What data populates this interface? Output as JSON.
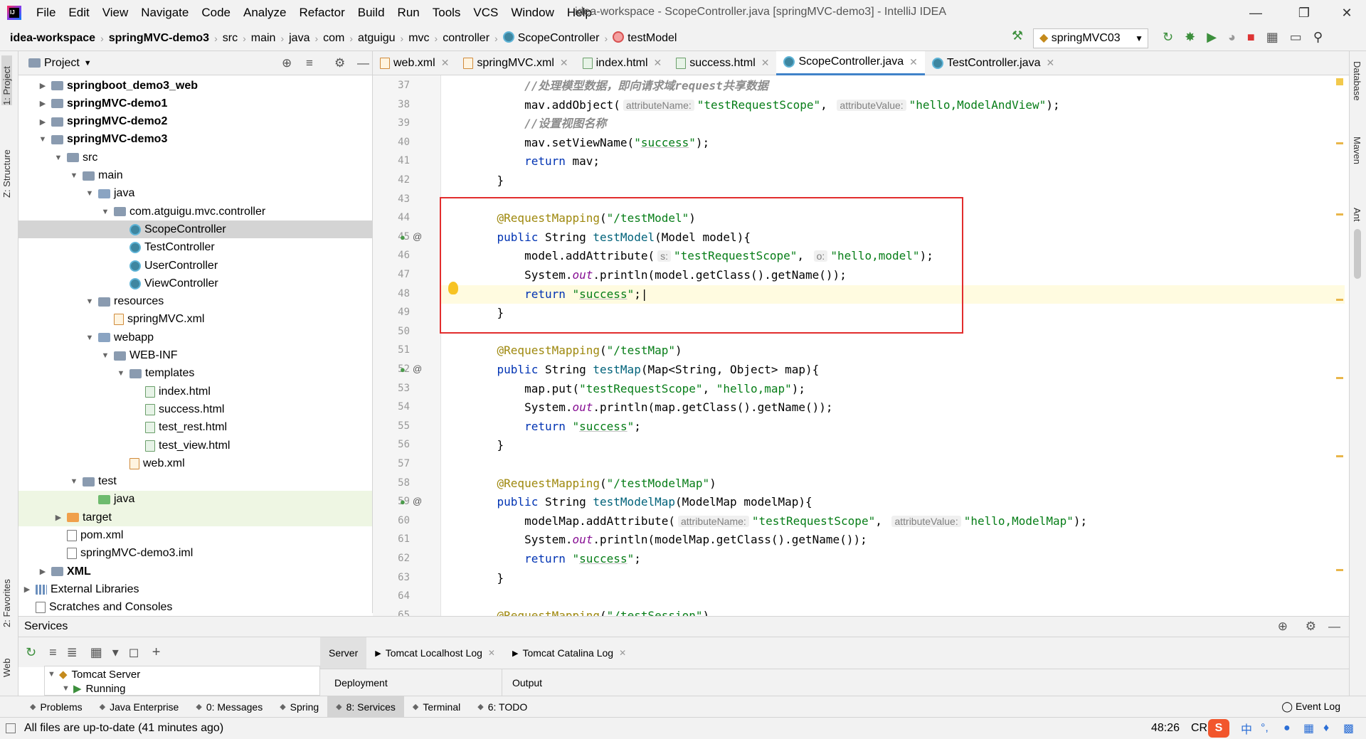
{
  "menu": {
    "items": [
      "File",
      "Edit",
      "View",
      "Navigate",
      "Code",
      "Analyze",
      "Refactor",
      "Build",
      "Run",
      "Tools",
      "VCS",
      "Window",
      "Help"
    ],
    "window_title": "idea-workspace - ScopeController.java [springMVC-demo3] - IntelliJ IDEA"
  },
  "breadcrumb": {
    "items": [
      {
        "label": "idea-workspace",
        "bold": true
      },
      {
        "label": "springMVC-demo3",
        "bold": true
      },
      {
        "label": "src"
      },
      {
        "label": "main"
      },
      {
        "label": "java"
      },
      {
        "label": "com"
      },
      {
        "label": "atguigu"
      },
      {
        "label": "mvc"
      },
      {
        "label": "controller"
      },
      {
        "label": "ScopeController",
        "icon": "class-icon"
      },
      {
        "label": "testModel",
        "icon": "method-icon"
      }
    ]
  },
  "run_config": {
    "label": "springMVC03"
  },
  "project_panel": {
    "title": "Project",
    "tree": [
      {
        "label": "springboot_demo3_web",
        "depth": 1,
        "arrow": "▶",
        "icon": "module",
        "bold": true
      },
      {
        "label": "springMVC-demo1",
        "depth": 1,
        "arrow": "▶",
        "icon": "module",
        "bold": true
      },
      {
        "label": "springMVC-demo2",
        "depth": 1,
        "arrow": "▶",
        "icon": "module",
        "bold": true
      },
      {
        "label": "springMVC-demo3",
        "depth": 1,
        "arrow": "▼",
        "icon": "module",
        "bold": true
      },
      {
        "label": "src",
        "depth": 2,
        "arrow": "▼",
        "icon": "folder"
      },
      {
        "label": "main",
        "depth": 3,
        "arrow": "▼",
        "icon": "folder"
      },
      {
        "label": "java",
        "depth": 4,
        "arrow": "▼",
        "icon": "folder-src"
      },
      {
        "label": "com.atguigu.mvc.controller",
        "depth": 5,
        "arrow": "▼",
        "icon": "package"
      },
      {
        "label": "ScopeController",
        "depth": 6,
        "arrow": "",
        "icon": "class",
        "selected": true
      },
      {
        "label": "TestController",
        "depth": 6,
        "arrow": "",
        "icon": "class"
      },
      {
        "label": "UserController",
        "depth": 6,
        "arrow": "",
        "icon": "class"
      },
      {
        "label": "ViewController",
        "depth": 6,
        "arrow": "",
        "icon": "class"
      },
      {
        "label": "resources",
        "depth": 4,
        "arrow": "▼",
        "icon": "folder-res"
      },
      {
        "label": "springMVC.xml",
        "depth": 5,
        "arrow": "",
        "icon": "xml"
      },
      {
        "label": "webapp",
        "depth": 4,
        "arrow": "▼",
        "icon": "folder-web"
      },
      {
        "label": "WEB-INF",
        "depth": 5,
        "arrow": "▼",
        "icon": "folder"
      },
      {
        "label": "templates",
        "depth": 6,
        "arrow": "▼",
        "icon": "folder"
      },
      {
        "label": "index.html",
        "depth": 7,
        "arrow": "",
        "icon": "html"
      },
      {
        "label": "success.html",
        "depth": 7,
        "arrow": "",
        "icon": "html"
      },
      {
        "label": "test_rest.html",
        "depth": 7,
        "arrow": "",
        "icon": "html"
      },
      {
        "label": "test_view.html",
        "depth": 7,
        "arrow": "",
        "icon": "html"
      },
      {
        "label": "web.xml",
        "depth": 6,
        "arrow": "",
        "icon": "xml"
      },
      {
        "label": "test",
        "depth": 3,
        "arrow": "▼",
        "icon": "folder"
      },
      {
        "label": "java",
        "depth": 4,
        "arrow": "",
        "icon": "folder-test",
        "highlight": true
      },
      {
        "label": "target",
        "depth": 2,
        "arrow": "▶",
        "icon": "folder-target",
        "highlight": true
      },
      {
        "label": "pom.xml",
        "depth": 2,
        "arrow": "",
        "icon": "maven"
      },
      {
        "label": "springMVC-demo3.iml",
        "depth": 2,
        "arrow": "",
        "icon": "file"
      },
      {
        "label": "XML",
        "depth": 1,
        "arrow": "▶",
        "icon": "module",
        "bold": true
      },
      {
        "label": "External Libraries",
        "depth": 0,
        "arrow": "▶",
        "icon": "lib"
      },
      {
        "label": "Scratches and Consoles",
        "depth": 0,
        "arrow": "",
        "icon": "scratch"
      }
    ]
  },
  "editor_tabs": [
    {
      "label": "web.xml",
      "icon": "xml"
    },
    {
      "label": "springMVC.xml",
      "icon": "xml"
    },
    {
      "label": "index.html",
      "icon": "html"
    },
    {
      "label": "success.html",
      "icon": "html"
    },
    {
      "label": "ScopeController.java",
      "icon": "class",
      "active": true
    },
    {
      "label": "TestController.java",
      "icon": "class"
    }
  ],
  "editor": {
    "lines": [
      {
        "n": "37",
        "html": "        <span class=\"cmt-cn\">//处理模型数据，即向请求域request共享数据</span>"
      },
      {
        "n": "38",
        "html": "        mav.addObject(<span class=\"hint\">attributeName:</span><span class=\"str\">\"testRequestScope\"</span>, <span class=\"hint\">attributeValue:</span><span class=\"str\">\"hello,ModelAndView\"</span>);"
      },
      {
        "n": "39",
        "html": "        <span class=\"cmt-cn\">//设置视图名称</span>"
      },
      {
        "n": "40",
        "html": "        mav.setViewName(<span class=\"str\">\"<span class=\"und\">success</span>\"</span>);"
      },
      {
        "n": "41",
        "html": "        <span class=\"kw\">return</span> mav;"
      },
      {
        "n": "42",
        "html": "    }"
      },
      {
        "n": "43",
        "html": ""
      },
      {
        "n": "44",
        "html": "    <span class=\"ann\">@RequestMapping</span>(<span class=\"str\">\"/testModel\"</span>)"
      },
      {
        "n": "45",
        "html": "    <span class=\"kw\">public</span> String <span class=\"mth\">testModel</span>(Model model){",
        "gutter": true
      },
      {
        "n": "46",
        "html": "        model.addAttribute(<span class=\"hint\">s:</span><span class=\"str\">\"testRequestScope\"</span>, <span class=\"hint\">o:</span><span class=\"str\">\"hello,model\"</span>);"
      },
      {
        "n": "47",
        "html": "        System.<span class=\"fld\">out</span>.println(model.getClass().getName());"
      },
      {
        "n": "48",
        "html": "        <span class=\"kw\">return</span> <span class=\"str\">\"<span class=\"und\">success</span>\"</span>;|",
        "caret": true
      },
      {
        "n": "49",
        "html": "    }"
      },
      {
        "n": "50",
        "html": ""
      },
      {
        "n": "51",
        "html": "    <span class=\"ann\">@RequestMapping</span>(<span class=\"str\">\"/testMap\"</span>)"
      },
      {
        "n": "52",
        "html": "    <span class=\"kw\">public</span> String <span class=\"mth\">testMap</span>(Map&lt;String, Object&gt; map){",
        "gutter": true
      },
      {
        "n": "53",
        "html": "        map.put(<span class=\"str\">\"testRequestScope\"</span>, <span class=\"str\">\"hello,map\"</span>);"
      },
      {
        "n": "54",
        "html": "        System.<span class=\"fld\">out</span>.println(map.getClass().getName());"
      },
      {
        "n": "55",
        "html": "        <span class=\"kw\">return</span> <span class=\"str\">\"<span class=\"und\">success</span>\"</span>;"
      },
      {
        "n": "56",
        "html": "    }"
      },
      {
        "n": "57",
        "html": ""
      },
      {
        "n": "58",
        "html": "    <span class=\"ann\">@RequestMapping</span>(<span class=\"str\">\"/testModelMap\"</span>)"
      },
      {
        "n": "59",
        "html": "    <span class=\"kw\">public</span> String <span class=\"mth\">testModelMap</span>(ModelMap modelMap){",
        "gutter": true
      },
      {
        "n": "60",
        "html": "        modelMap.addAttribute(<span class=\"hint\">attributeName:</span><span class=\"str\">\"testRequestScope\"</span>, <span class=\"hint\">attributeValue:</span><span class=\"str\">\"hello,ModelMap\"</span>);"
      },
      {
        "n": "61",
        "html": "        System.<span class=\"fld\">out</span>.println(modelMap.getClass().getName());"
      },
      {
        "n": "62",
        "html": "        <span class=\"kw\">return</span> <span class=\"str\">\"<span class=\"und\">success</span>\"</span>;"
      },
      {
        "n": "63",
        "html": "    }"
      },
      {
        "n": "64",
        "html": ""
      },
      {
        "n": "65",
        "html": "    <span class=\"ann\">@RequestMapping</span>(<span class=\"str\">\"/testSession\"</span>)"
      }
    ]
  },
  "left_stripe": {
    "project_tab": "1: Project",
    "structure_tab": "Z: Structure",
    "favorites_tab": "2: Favorites",
    "web_tab": "Web"
  },
  "right_stripe": {
    "database_tab": "Database",
    "maven_tab": "Maven",
    "ant_tab": "Ant"
  },
  "services": {
    "title": "Services",
    "tree_items": [
      "Tomcat Server",
      "Running"
    ],
    "tabs": [
      {
        "label": "Server",
        "active": true
      },
      {
        "label": "Tomcat Localhost Log"
      },
      {
        "label": "Tomcat Catalina Log"
      }
    ],
    "sub_tabs": [
      "Deployment",
      "Output"
    ]
  },
  "tool_windows": [
    {
      "label": "Problems"
    },
    {
      "label": "Java Enterprise"
    },
    {
      "label": "0: Messages"
    },
    {
      "label": "Spring"
    },
    {
      "label": "8: Services",
      "active": true
    },
    {
      "label": "Terminal"
    },
    {
      "label": "6: TODO"
    }
  ],
  "event_log": "Event Log",
  "status": {
    "message": "All files are up-to-date (41 minutes ago)",
    "position": "48:26",
    "line_sep": "CRL",
    "ime": "中"
  },
  "colors": {
    "accent": "#4083c9",
    "highlight_box": "#e22d2d",
    "keyword": "#0033b3",
    "string": "#067d17",
    "annotation": "#9e880d"
  }
}
